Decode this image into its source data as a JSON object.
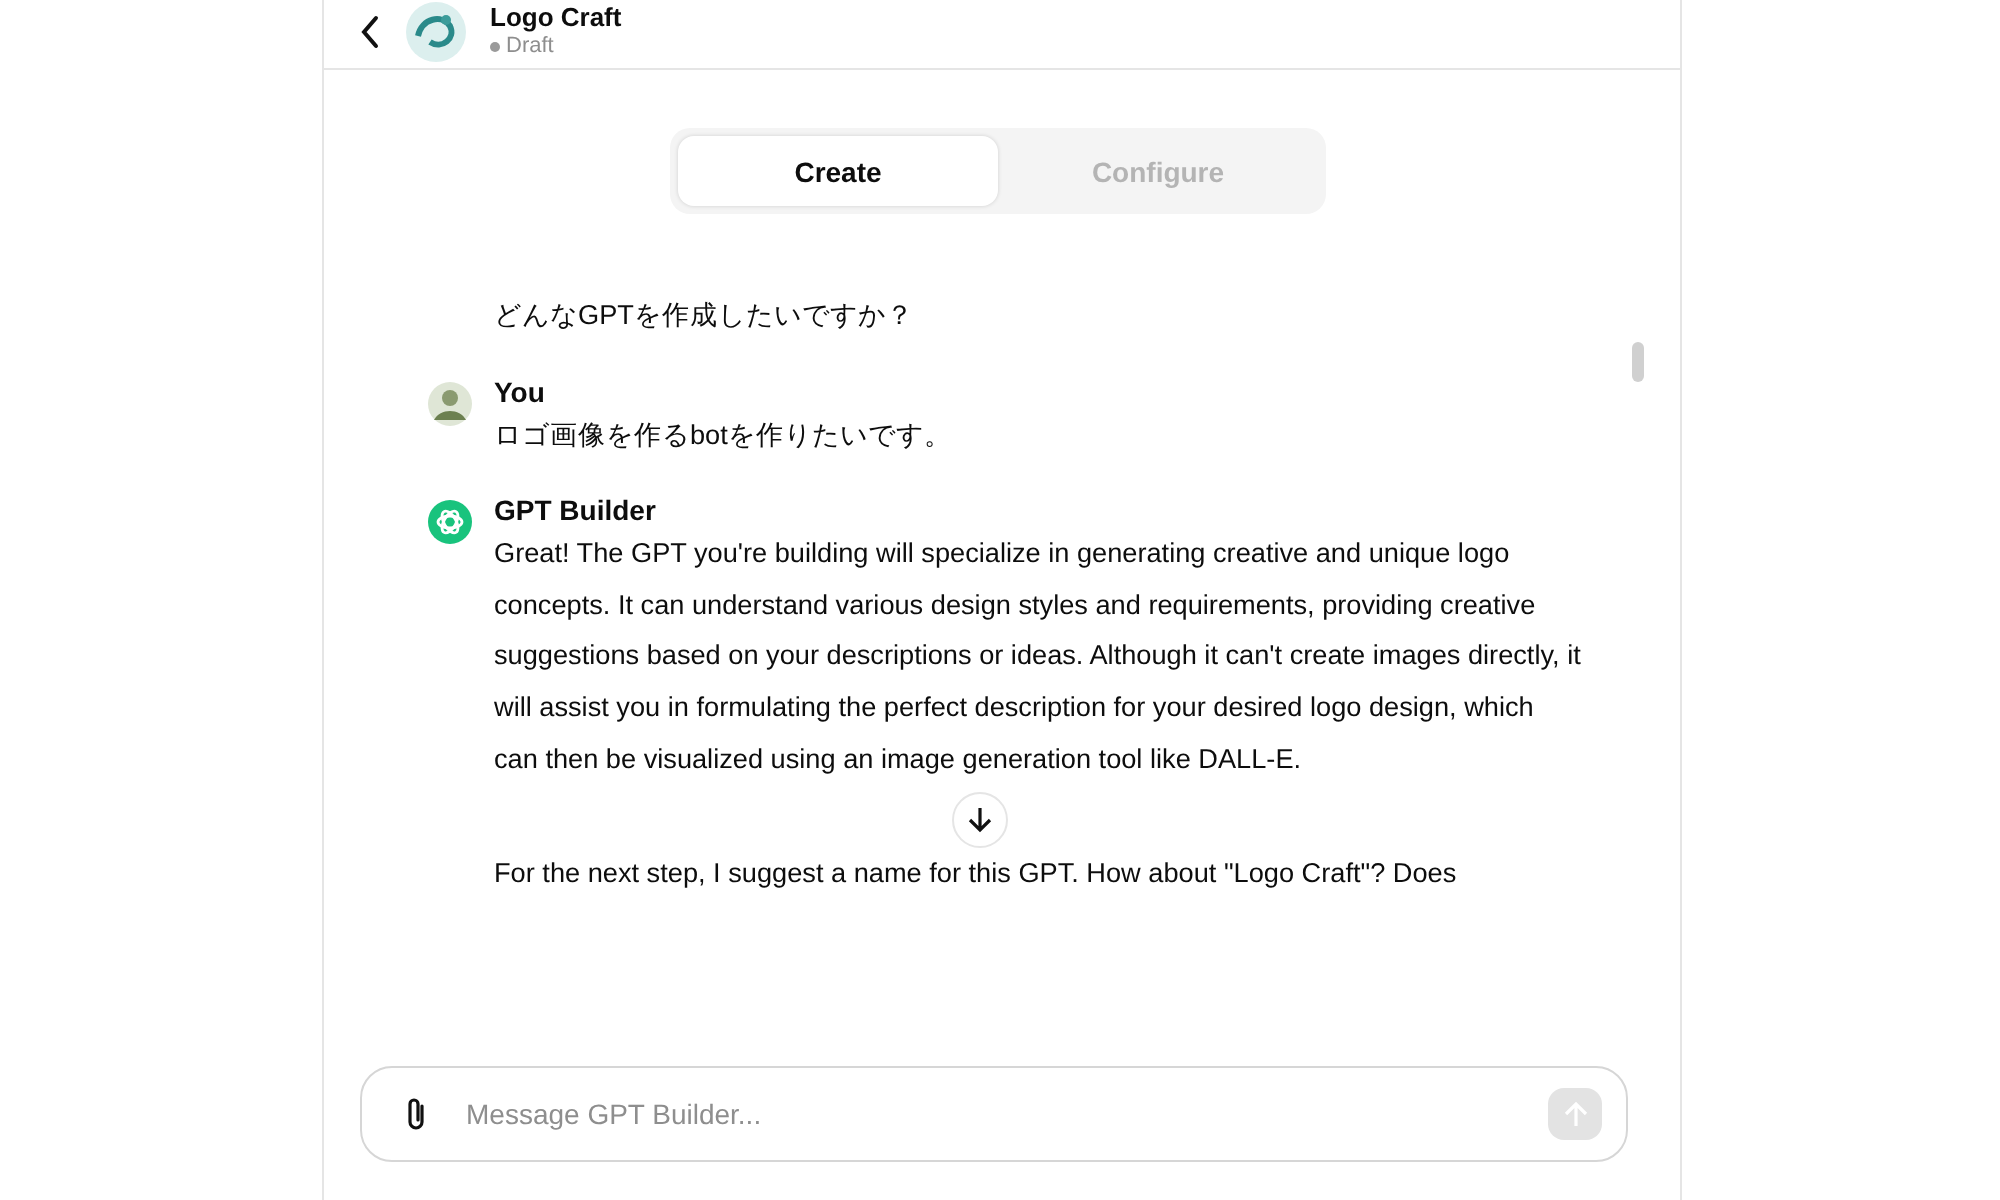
{
  "header": {
    "title": "Logo Craft",
    "status": "Draft"
  },
  "tabs": [
    {
      "label": "Create",
      "selected": true
    },
    {
      "label": "Configure",
      "selected": false
    }
  ],
  "messages": [
    {
      "kind": "plain",
      "paragraphs": [
        "どんなGPTを作成したいですか？"
      ]
    },
    {
      "kind": "user",
      "author": "You",
      "paragraphs": [
        "ロゴ画像を作るbotを作りたいです。"
      ]
    },
    {
      "kind": "builder",
      "author": "GPT Builder",
      "paragraphs": [
        "Great! The GPT you're building will specialize in generating creative and unique logo concepts. It can understand various design styles and requirements, providing creative suggestions based on your descriptions or ideas. Although it can't create images directly, it will assist you in formulating the perfect description for your desired logo design, which can then be visualized using an image generation tool like DALL-E.",
        "For the next step, I suggest a name for this GPT. How about \"Logo Craft\"? Does"
      ]
    }
  ],
  "composer": {
    "placeholder": "Message GPT Builder..."
  }
}
